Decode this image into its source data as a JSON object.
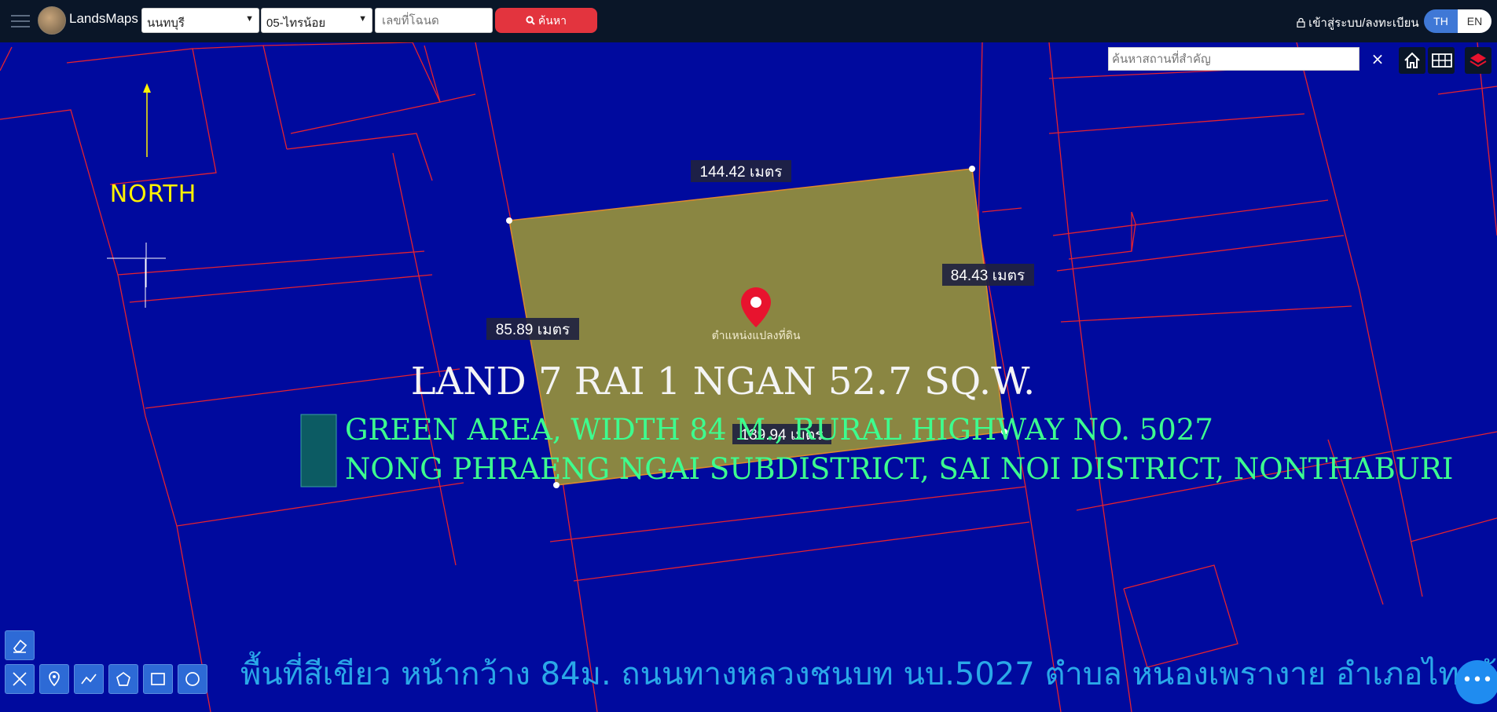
{
  "header": {
    "brand": "LandsMaps",
    "province": "นนทบุรี",
    "district": "05-ไทรน้อย",
    "deed_placeholder": "เลขที่โฉนด",
    "search_button": "ค้นหา",
    "login": "เข้าสู่ระบบ/ลงทะเบียน",
    "lang_th": "TH",
    "lang_en": "EN"
  },
  "map_controls": {
    "place_search_placeholder": "ค้นหาสถานที่สำคัญ",
    "close": "×"
  },
  "map": {
    "north_label": "NORTH",
    "measurements": {
      "top": "144.42 เมตร",
      "right": "84.43 เมตร",
      "left": "85.89 เมตร",
      "bottom": "139.94 เมตร"
    },
    "pin_label": "ตำแหน่งแปลงที่ดิน",
    "overlay": {
      "line1": "LAND 7 RAI 1 NGAN 52.7 SQ.W.",
      "line2": "GREEN AREA, WIDTH 84 M., RURAL HIGHWAY NO. 5027",
      "line3": "NONG PHRAENG NGAI SUBDISTRICT, SAI NOI DISTRICT, NONTHABURI",
      "thai_line": "พื้นที่สีเขียว หน้ากว้าง 84ม. ถนนทางหลวงชนบท นบ.5027 ตำบล หนองเพรางาย อำเภอไทรน้อย นนทบุรี"
    }
  },
  "more_button": "•••",
  "colors": {
    "map_bg": "#000a9e",
    "parcel_line": "#e52230",
    "plot_fill": "#8a8642",
    "overlay_white": "#f4f4f4",
    "overlay_green": "#3dff8f",
    "overlay_thai": "#2aa8e8",
    "north": "#fff200"
  }
}
